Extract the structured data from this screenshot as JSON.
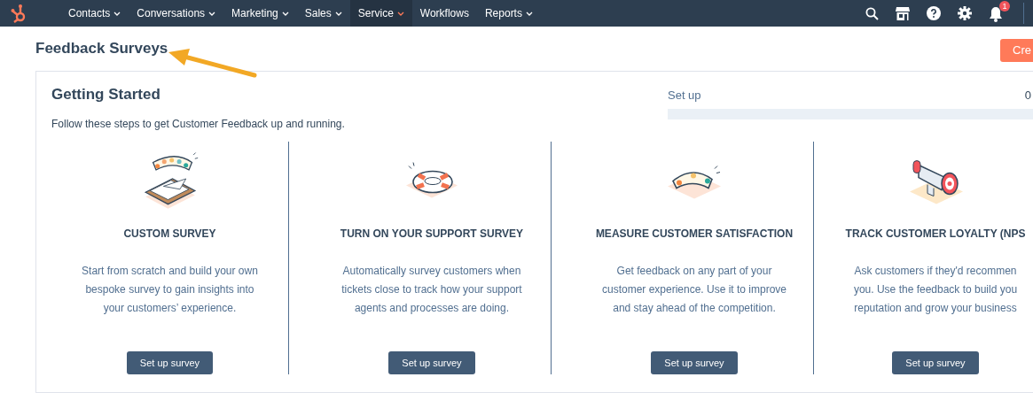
{
  "nav": {
    "items": [
      {
        "label": "Contacts",
        "has_menu": true,
        "selected": false
      },
      {
        "label": "Conversations",
        "has_menu": true,
        "selected": false
      },
      {
        "label": "Marketing",
        "has_menu": true,
        "selected": false
      },
      {
        "label": "Sales",
        "has_menu": true,
        "selected": false
      },
      {
        "label": "Service",
        "has_menu": true,
        "selected": true
      },
      {
        "label": "Workflows",
        "has_menu": false,
        "selected": false
      },
      {
        "label": "Reports",
        "has_menu": true,
        "selected": false
      }
    ],
    "notification_count": "1"
  },
  "page": {
    "title": "Feedback Surveys",
    "create_button": "Cre"
  },
  "getting_started": {
    "title": "Getting Started",
    "intro": "Follow these steps to get Customer Feedback up and running.",
    "progress": {
      "label": "Set up",
      "reading": "0",
      "level": 0
    },
    "steps": [
      {
        "kind": "custom",
        "title": "CUSTOM SURVEY",
        "lines": [
          "Start from scratch and build your own",
          "bespoke survey to gain insights into",
          "your customers’ experience."
        ],
        "button": "Set up survey"
      },
      {
        "kind": "support",
        "title": "TURN ON YOUR SUPPORT SURVEY",
        "lines": [
          "Automatically survey customers when",
          "tickets close to track how your support",
          "agents and processes are doing."
        ],
        "button": "Set up survey"
      },
      {
        "kind": "satisfaction",
        "title": "MEASURE CUSTOMER SATISFACTION",
        "lines": [
          "Get feedback on any part of your",
          "customer experience. Use it to improve",
          "and stay ahead of the competition."
        ],
        "button": "Set up survey"
      },
      {
        "kind": "loyalty",
        "title": "TRACK CUSTOMER LOYALTY (NPS",
        "lines": [
          "Ask customers if they'd recommen",
          "you. Use the feedback to build you",
          "reputation and grow your business"
        ],
        "button": "Set up survey"
      }
    ]
  }
}
